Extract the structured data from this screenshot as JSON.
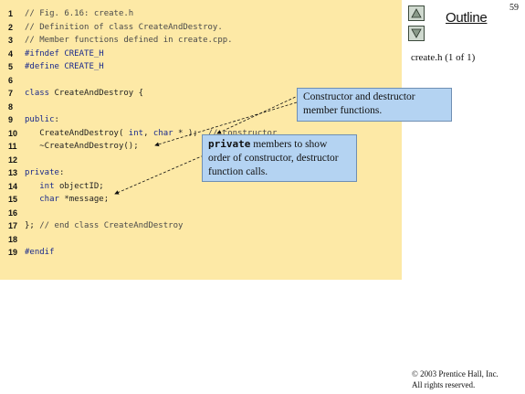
{
  "code_lines": [
    {
      "num": "1",
      "segments": [
        {
          "t": "// Fig. 6.16: create.h",
          "c": "cmt"
        }
      ]
    },
    {
      "num": "2",
      "segments": [
        {
          "t": "// Definition of class CreateAndDestroy.",
          "c": "cmt"
        }
      ]
    },
    {
      "num": "3",
      "segments": [
        {
          "t": "// Member functions defined in create.cpp.",
          "c": "cmt"
        }
      ]
    },
    {
      "num": "4",
      "segments": [
        {
          "t": "#ifndef CREATE_H",
          "c": "kw"
        }
      ]
    },
    {
      "num": "5",
      "segments": [
        {
          "t": "#define CREATE_H",
          "c": "kw"
        }
      ]
    },
    {
      "num": "6",
      "segments": []
    },
    {
      "num": "7",
      "segments": [
        {
          "t": "class ",
          "c": "kw"
        },
        {
          "t": "CreateAndDestroy {",
          "c": ""
        }
      ]
    },
    {
      "num": "8",
      "segments": []
    },
    {
      "num": "9",
      "segments": [
        {
          "t": "public",
          "c": "kw"
        },
        {
          "t": ":",
          "c": ""
        }
      ]
    },
    {
      "num": "10",
      "segments": [
        {
          "t": "   CreateAndDestroy( ",
          "c": ""
        },
        {
          "t": "int",
          "c": "kw"
        },
        {
          "t": ", ",
          "c": ""
        },
        {
          "t": "char",
          "c": "kw"
        },
        {
          "t": " * );  ",
          "c": ""
        },
        {
          "t": "// constructor",
          "c": "cmt"
        }
      ]
    },
    {
      "num": "11",
      "segments": [
        {
          "t": "   ~CreateAndDestroy();",
          "c": ""
        }
      ]
    },
    {
      "num": "12",
      "segments": []
    },
    {
      "num": "13",
      "segments": [
        {
          "t": "private",
          "c": "kw"
        },
        {
          "t": ":",
          "c": ""
        }
      ]
    },
    {
      "num": "14",
      "segments": [
        {
          "t": "   ",
          "c": ""
        },
        {
          "t": "int",
          "c": "kw"
        },
        {
          "t": " objectID;",
          "c": ""
        }
      ]
    },
    {
      "num": "15",
      "segments": [
        {
          "t": "   ",
          "c": ""
        },
        {
          "t": "char",
          "c": "kw"
        },
        {
          "t": " *message;",
          "c": ""
        }
      ]
    },
    {
      "num": "16",
      "segments": []
    },
    {
      "num": "17",
      "segments": [
        {
          "t": "}; ",
          "c": ""
        },
        {
          "t": "// end class CreateAndDestroy",
          "c": "cmt"
        }
      ]
    },
    {
      "num": "18",
      "segments": []
    },
    {
      "num": "19",
      "segments": [
        {
          "t": "#endif",
          "c": "kw"
        }
      ]
    }
  ],
  "callouts": {
    "ctor_dtor": "Constructor and destructor member functions.",
    "private_keyword": "private",
    "private_rest": " members to show order of constructor, destructor function calls."
  },
  "sidebar": {
    "page_number": "59",
    "outline_title": "Outline",
    "file_label": "create.h (1 of 1)",
    "copyright_line1": "© 2003 Prentice Hall, Inc.",
    "copyright_line2": "All rights reserved."
  },
  "icons": {
    "nav_up": "triangle-up-icon",
    "nav_down": "triangle-down-icon"
  },
  "colors": {
    "code_background": "#fde9a6",
    "callout_background": "#b4d3f2",
    "keyword": "#1a2a8c"
  }
}
